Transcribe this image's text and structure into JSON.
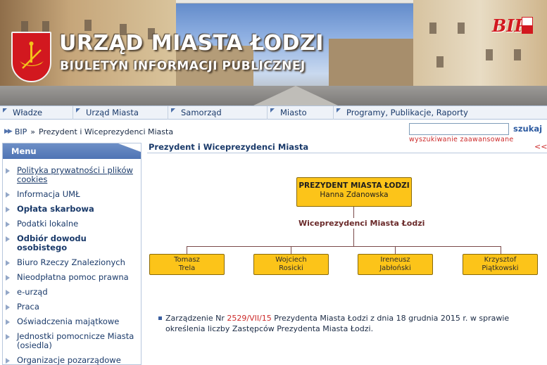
{
  "header": {
    "title_main": "URZĄD MIASTA ŁODZI",
    "title_sub": "BIULETYN INFORMACJI PUBLICZNEJ",
    "bip_logo": "BIP",
    "crest_icon": "lodz-coat-of-arms-icon",
    "colors": {
      "crest": "#d2181f",
      "accent": "#4f74b4"
    }
  },
  "nav": {
    "items": [
      {
        "label": "Władze"
      },
      {
        "label": "Urząd Miasta"
      },
      {
        "label": "Samorząd"
      },
      {
        "label": "Miasto"
      },
      {
        "label": "Programy, Publikacje, Raporty"
      }
    ]
  },
  "breadcrumb": {
    "root": "BIP",
    "separator": "»",
    "current": "Prezydent i Wiceprezydenci Miasta"
  },
  "search": {
    "value": "",
    "placeholder": "",
    "button": "szukaj",
    "advanced": "wyszukiwanie zaawansowane"
  },
  "sidebar": {
    "header": "Menu",
    "items": [
      {
        "label": "Polityka prywatności i plików cookies",
        "style": "underline"
      },
      {
        "label": "Informacja UMŁ",
        "style": "normal"
      },
      {
        "label": "Opłata skarbowa",
        "style": "bold"
      },
      {
        "label": "Podatki lokalne",
        "style": "normal"
      },
      {
        "label": "Odbiór dowodu osobistego",
        "style": "bold"
      },
      {
        "label": "Biuro Rzeczy Znalezionych",
        "style": "normal"
      },
      {
        "label": "Nieodpłatna pomoc prawna",
        "style": "normal"
      },
      {
        "label": "e-urząd",
        "style": "normal"
      },
      {
        "label": "Praca",
        "style": "normal"
      },
      {
        "label": "Oświadczenia majątkowe",
        "style": "normal"
      },
      {
        "label": "Jednostki pomocnicze Miasta (osiedla)",
        "style": "normal"
      },
      {
        "label": "Organizacje pozarządowe",
        "style": "normal"
      }
    ]
  },
  "main": {
    "page_title": "Prezydent i Wiceprezydenci Miasta",
    "back_link": "<<",
    "org_chart": {
      "president_role": "PREZYDENT MIASTA ŁODZI",
      "president_name": "Hanna Zdanowska",
      "vice_label": "Wiceprezydenci Miasta Łodzi",
      "vice_presidents": [
        {
          "first": "Tomasz",
          "last": "Trela"
        },
        {
          "first": "Wojciech",
          "last": "Rosicki"
        },
        {
          "first": "Ireneusz",
          "last": "Jabłoński"
        },
        {
          "first": "Krzysztof",
          "last": "Piątkowski"
        }
      ],
      "box_color": "#fcc419"
    },
    "decree": {
      "prefix": "Zarządzenie Nr ",
      "number": "2529/VII/15",
      "line1_rest": " Prezydenta Miasta Łodzi z dnia 18 grudnia 2015 r. w sprawie",
      "line2": "określenia liczby Zastępców Prezydenta Miasta Łodzi."
    }
  }
}
